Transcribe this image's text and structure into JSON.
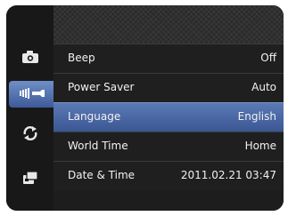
{
  "sidebar": {
    "tabs": [
      {
        "icon": "camera-icon"
      },
      {
        "icon": "wrench-icon"
      },
      {
        "icon": "refresh-icon"
      },
      {
        "icon": "playback-icon"
      }
    ],
    "active_index": 1
  },
  "menu": {
    "selected_index": 2,
    "rows": [
      {
        "label": "Beep",
        "value": "Off"
      },
      {
        "label": "Power Saver",
        "value": "Auto"
      },
      {
        "label": "Language",
        "value": "English"
      },
      {
        "label": "World Time",
        "value": "Home"
      },
      {
        "label": "Date & Time",
        "value": "2011.02.21 03:47"
      }
    ]
  },
  "colors": {
    "selection": "#4a68a6",
    "background": "#1d1d1d",
    "text": "#f2f2f2"
  }
}
